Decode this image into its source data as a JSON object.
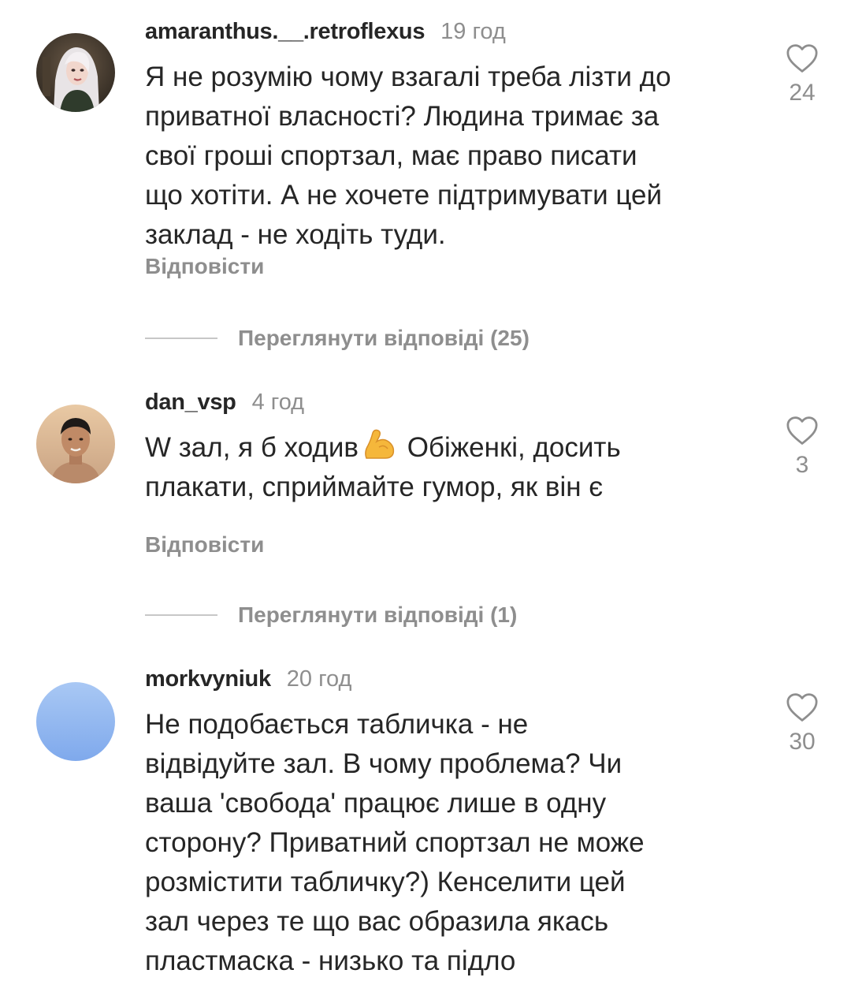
{
  "comments": [
    {
      "username": "amaranthus.__.retroflexus",
      "time": "19 год",
      "lines": [
        "Я не розумію чому взагалі треба лізти до",
        "приватної власності? Людина тримає за",
        "свої гроші спортзал, має право писати",
        "що хотіти. А не хочете підтримувати цей",
        "заклад - не ходіть туди."
      ],
      "reply_label": "Відповісти",
      "likes": "24",
      "view_replies": "Переглянути відповіді (25)",
      "avatar": "avatar-woman-white-hair"
    },
    {
      "username": "dan_vsp",
      "time": "4 год",
      "line1_before_emoji": "W зал, я б ходив",
      "emoji": "flexed-biceps-emoji",
      "line1_after_emoji": " Обіженкі, досить",
      "line2": "плакати, сприймайте гумор, як він є",
      "reply_label": "Відповісти",
      "likes": "3",
      "view_replies": "Переглянути відповіді (1)",
      "avatar": "avatar-young-man"
    },
    {
      "username": "morkvyniuk",
      "time": "20 год",
      "lines": [
        "Не подобається табличка - не",
        "відвідуйте зал. В чому проблема? Чи",
        "ваша 'свобода' працює лише в одну",
        "сторону? Приватний спортзал не може",
        "розмістити табличку?) Кенселити цей",
        "зал через те що вас образила якась",
        "пластмаска - низько та підло"
      ],
      "likes": "30",
      "avatar": "avatar-blue-gradient"
    }
  ],
  "icons": {
    "like": "heart-outline-icon"
  },
  "colors": {
    "text": "#262626",
    "muted": "#8e8e8e",
    "divider": "#c7c7c7"
  }
}
